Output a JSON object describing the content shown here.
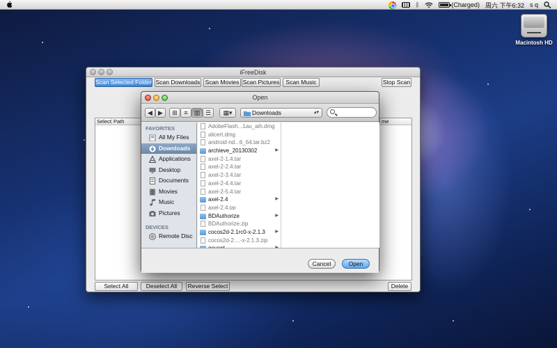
{
  "menubar": {
    "battery_label": "(Charged)",
    "clock": "周六 下午6:32",
    "user": "s q"
  },
  "desktop": {
    "disk_label": "Macintosh HD"
  },
  "app": {
    "title": "iFreeDisk",
    "buttons": {
      "scan_selected": "Scan Selected Folder",
      "scan_downloads": "Scan Downloads",
      "scan_movies": "Scan Movies",
      "scan_pictures": "Scan Pictures",
      "scan_music": "Scan Music",
      "stop_scan": "Stop Scan",
      "select_all": "Select All",
      "deselect_all": "Deselect All",
      "reverse_select": "Reverse Select",
      "delete": "Delete"
    },
    "table_headers": [
      "Select",
      "Path",
      "me"
    ]
  },
  "dialog": {
    "title": "Open",
    "location": "Downloads",
    "sidebar": {
      "favorites_header": "FAVORITES",
      "favorites": [
        {
          "label": "All My Files",
          "icon": "all-files-icon",
          "selected": false
        },
        {
          "label": "Downloads",
          "icon": "downloads-icon",
          "selected": true
        },
        {
          "label": "Applications",
          "icon": "applications-icon",
          "selected": false
        },
        {
          "label": "Desktop",
          "icon": "desktop-icon",
          "selected": false
        },
        {
          "label": "Documents",
          "icon": "documents-icon",
          "selected": false
        },
        {
          "label": "Movies",
          "icon": "movies-icon",
          "selected": false
        },
        {
          "label": "Music",
          "icon": "music-icon",
          "selected": false
        },
        {
          "label": "Pictures",
          "icon": "pictures-icon",
          "selected": false
        }
      ],
      "devices_header": "DEVICES",
      "devices": [
        {
          "label": "Remote Disc",
          "icon": "remote-disc-icon"
        }
      ]
    },
    "files": [
      {
        "name": "AdobeFlash...1au_aih.dmg",
        "type": "file"
      },
      {
        "name": "alicert.dmg",
        "type": "file"
      },
      {
        "name": "android-nd...6_64.tar.bz2",
        "type": "file"
      },
      {
        "name": "archieve_20130302",
        "type": "folder"
      },
      {
        "name": "axel-2-1.4.tar",
        "type": "file"
      },
      {
        "name": "axel-2-2.4.tar",
        "type": "file"
      },
      {
        "name": "axel-2-3.4.tar",
        "type": "file"
      },
      {
        "name": "axel-2-4.4.tar",
        "type": "file"
      },
      {
        "name": "axel-2-5.4.tar",
        "type": "file"
      },
      {
        "name": "axel-2.4",
        "type": "folder"
      },
      {
        "name": "axel-2.4.tar",
        "type": "file"
      },
      {
        "name": "BDAuthorize",
        "type": "folder"
      },
      {
        "name": "BDAuthorize.zip",
        "type": "file"
      },
      {
        "name": "cocos2d-2.1rc0-x-2.1.3",
        "type": "folder"
      },
      {
        "name": "cocos2d-2....-x-2.1.3.zip",
        "type": "file"
      },
      {
        "name": "gevent",
        "type": "folder"
      }
    ],
    "cancel": "Cancel",
    "open": "Open"
  }
}
